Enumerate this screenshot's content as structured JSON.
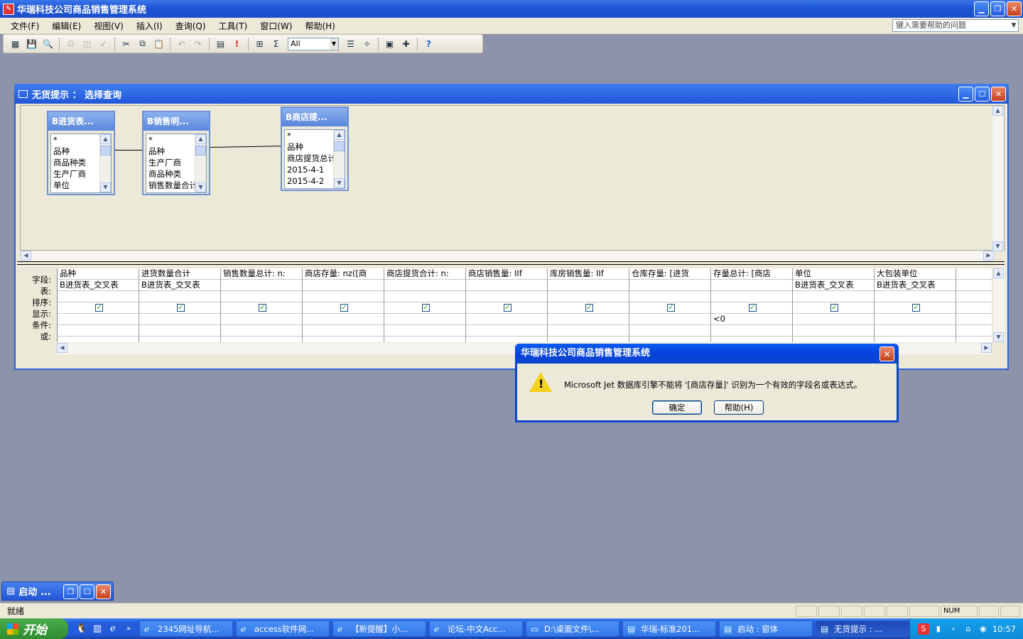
{
  "app": {
    "title": "华瑞科技公司商品销售管理系统"
  },
  "menu": [
    "文件(F)",
    "编辑(E)",
    "视图(V)",
    "插入(I)",
    "查询(Q)",
    "工具(T)",
    "窗口(W)",
    "帮助(H)"
  ],
  "help_box": {
    "placeholder": "键入需要帮助的问题"
  },
  "toolbar": {
    "combo_value": "All"
  },
  "query_window": {
    "title": "无货提示 ： 选择查询"
  },
  "tables": [
    {
      "title": "B进货表...",
      "fields": [
        "*",
        "品种",
        "商品种类",
        "生产厂商",
        "单位"
      ]
    },
    {
      "title": "B销售明...",
      "fields": [
        "*",
        "品种",
        "生产厂商",
        "商品种类",
        "销售数量合计"
      ]
    },
    {
      "title": "B商店提...",
      "fields": [
        "*",
        "品种",
        "商店提货总计",
        "2015-4-1",
        "2015-4-2"
      ]
    }
  ],
  "grid": {
    "row_labels": [
      "字段:",
      "表:",
      "排序:",
      "显示:",
      "条件:",
      "或:"
    ],
    "columns": [
      {
        "field": "品种",
        "table": "B进货表_交叉表",
        "show": true,
        "criteria": ""
      },
      {
        "field": "进货数量合计",
        "table": "B进货表_交叉表",
        "show": true,
        "criteria": ""
      },
      {
        "field": "销售数量总计: n:",
        "table": "",
        "show": true,
        "criteria": ""
      },
      {
        "field": "商店存量: nz([商",
        "table": "",
        "show": true,
        "criteria": ""
      },
      {
        "field": "商店提货合计: n:",
        "table": "",
        "show": true,
        "criteria": ""
      },
      {
        "field": "商店销售量: IIf",
        "table": "",
        "show": true,
        "criteria": ""
      },
      {
        "field": "库房销售量: IIf",
        "table": "",
        "show": true,
        "criteria": ""
      },
      {
        "field": "仓库存量: [进货",
        "table": "",
        "show": true,
        "criteria": ""
      },
      {
        "field": "存量总计: [商店",
        "table": "",
        "show": true,
        "criteria": "<0"
      },
      {
        "field": "单位",
        "table": "B进货表_交叉表",
        "show": true,
        "criteria": ""
      },
      {
        "field": "大包装单位",
        "table": "B进货表_交叉表",
        "show": true,
        "criteria": ""
      },
      {
        "field": "",
        "table": "",
        "show": false,
        "criteria": ""
      }
    ]
  },
  "minimized": {
    "title": "启动 ..."
  },
  "status": {
    "text": "就绪",
    "num": "NUM"
  },
  "taskbar": {
    "start": "开始",
    "tasks": [
      "2345网址导航...",
      "access软件网...",
      "【新提醒】小...",
      "论坛-中文Acc...",
      "D:\\桌面文件\\...",
      "华瑞-标准201...",
      "启动 : 窗体",
      "无货提示 : ..."
    ],
    "clock": "10:57"
  },
  "dialog": {
    "title": "华瑞科技公司商品销售管理系统",
    "message": "Microsoft Jet 数据库引擎不能将 '[商店存量]' 识别为一个有效的字段名或表达式。",
    "ok": "确定",
    "help": "帮助(H)"
  }
}
